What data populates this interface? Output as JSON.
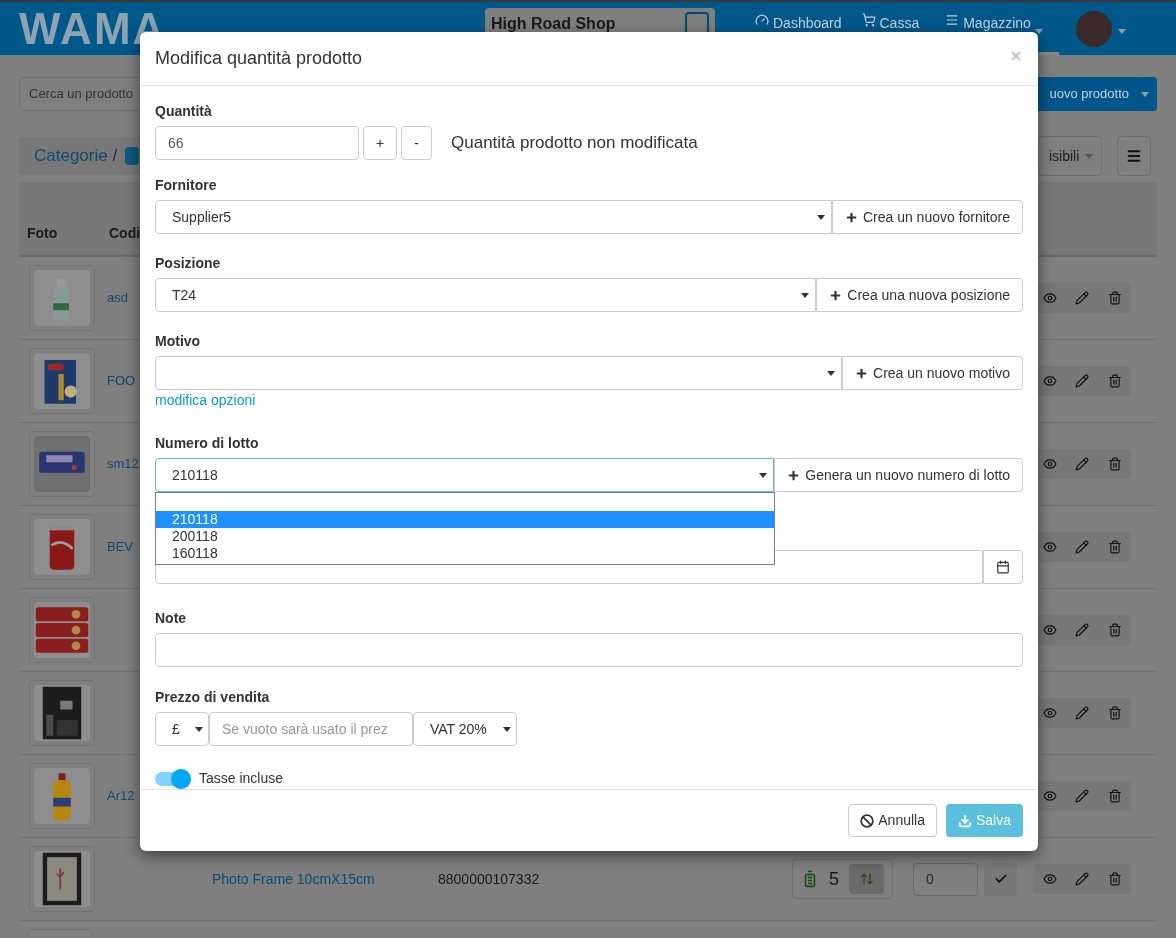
{
  "navbar": {
    "logo": "WAMA",
    "shop": "High Road Shop",
    "items": [
      {
        "label": "Dashboard",
        "kind": "gauge",
        "selected": false
      },
      {
        "label": "Cassa",
        "kind": "cart",
        "selected": false
      },
      {
        "label": "Magazzino",
        "kind": "menu",
        "selected": true
      }
    ]
  },
  "toolbar": {
    "search_placeholder": "Cerca un prodotto",
    "new_button": "uovo prodotto"
  },
  "breadcrumb": {
    "label": "Categorie",
    "separator": "/"
  },
  "columns_button": "isibili",
  "table": {
    "columns": [
      "Foto",
      "Codi"
    ],
    "rows": [
      {
        "kind": "picture",
        "code": "asd"
      },
      {
        "kind": "picture",
        "code": "FOO"
      },
      {
        "kind": "picture",
        "code": "sm12"
      },
      {
        "kind": "picture",
        "code": "BEV"
      },
      {
        "kind": "picture"
      },
      {
        "kind": "picture"
      },
      {
        "kind": "picture",
        "code": "Ar12"
      },
      {
        "kind": "picture",
        "name": "Photo Frame 10cmX15cm",
        "barcode": "8800000107332",
        "stock": "5",
        "quantity": "0"
      }
    ]
  },
  "modal": {
    "title": "Modifica quantità prodotto",
    "quantity": {
      "label": "Quantità",
      "value": "66",
      "plus": "+",
      "minus": "-",
      "status": "Quantità prodotto non modificata"
    },
    "supplier": {
      "label": "Fornitore",
      "value": "Supplier5",
      "button": "Crea un nuovo fornitore"
    },
    "position": {
      "label": "Posizione",
      "value": "T24",
      "button": "Crea una nuova posizione"
    },
    "reason": {
      "label": "Motivo",
      "button": "Crea un nuovo motivo",
      "link": "modifica opzioni"
    },
    "lot": {
      "label": "Numero di lotto",
      "value": "210118",
      "button": "Genera un nuovo numero di lotto",
      "expanded": true,
      "options": [
        {
          "label": "210118",
          "selected": true
        },
        {
          "label": "200118",
          "selected": false
        },
        {
          "label": "160118",
          "selected": false
        }
      ]
    },
    "note": {
      "label": "Note"
    },
    "price": {
      "label": "Prezzo di vendita",
      "currency": "£",
      "placeholder": "Se vuoto sarà usato il prez",
      "vat": "VAT 20%"
    },
    "taxes": {
      "label": "Tasse incluse",
      "on": true
    },
    "cancel": "Annulla",
    "save": "Salva"
  }
}
